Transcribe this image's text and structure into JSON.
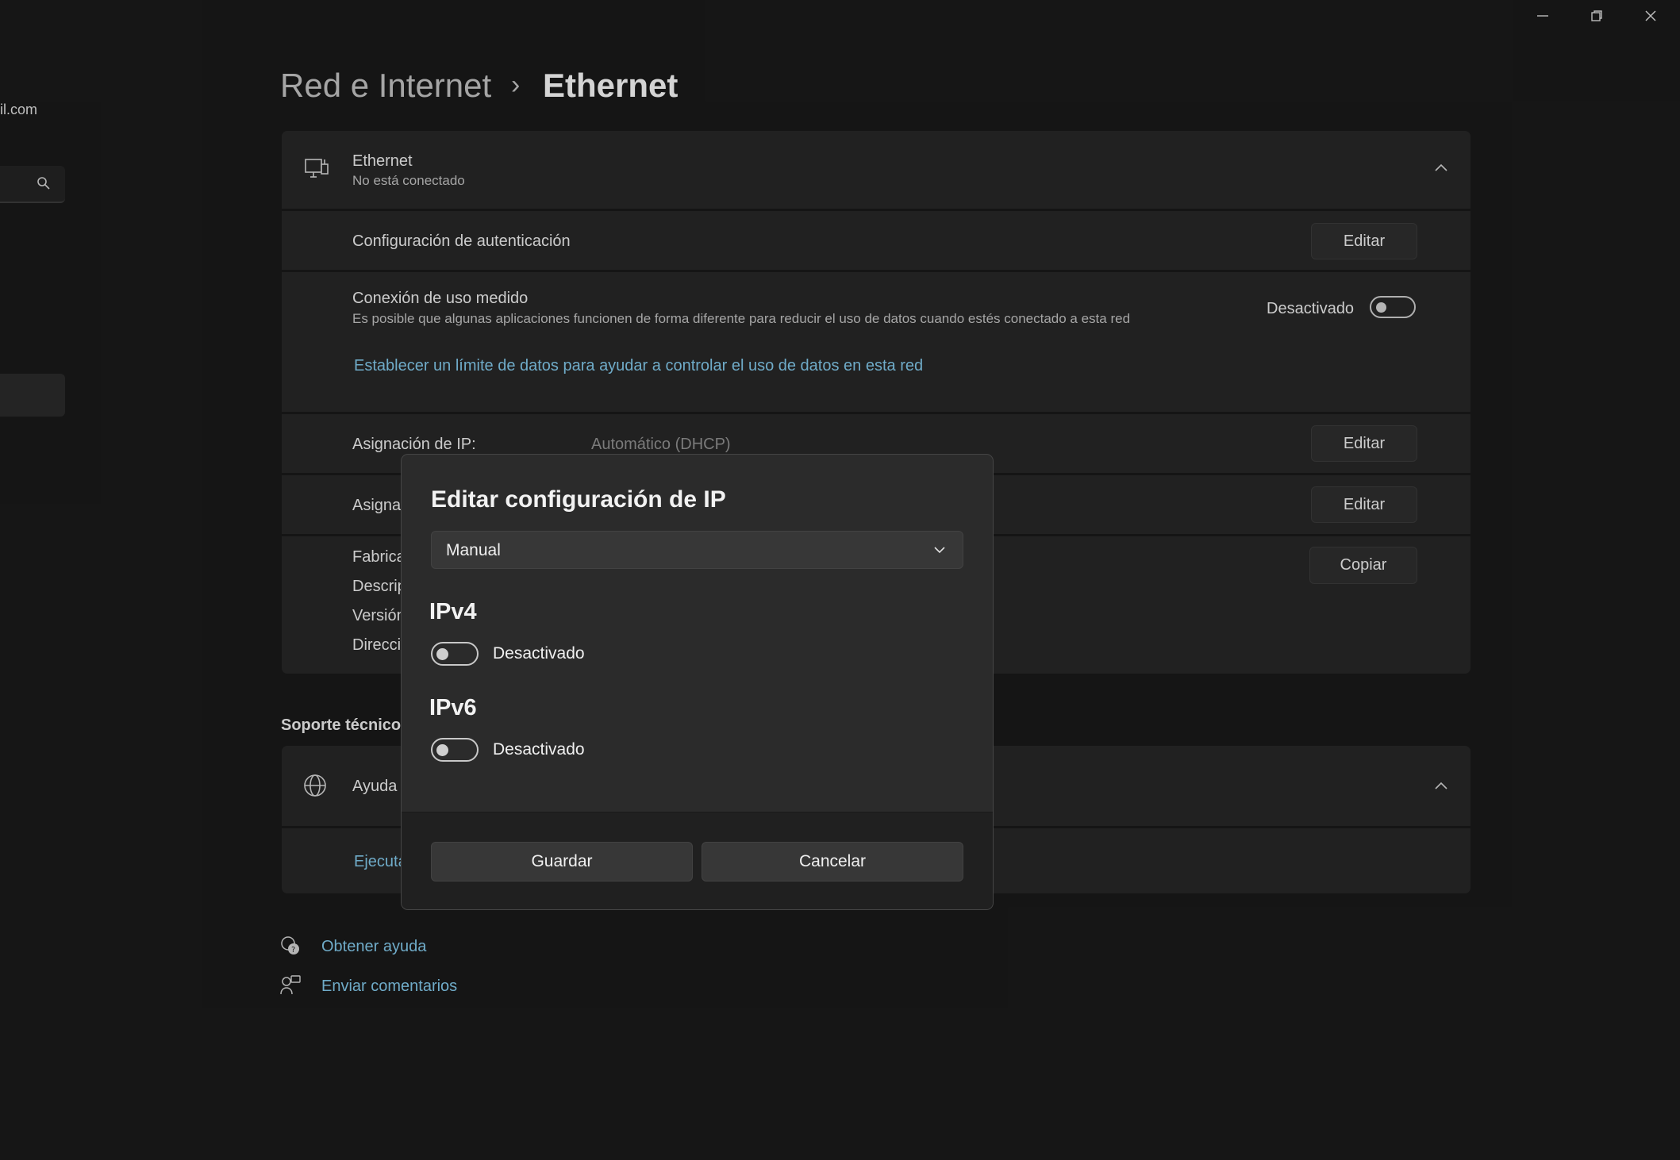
{
  "window": {
    "minimize_icon": "minimize-icon",
    "restore_icon": "restore-icon",
    "close_icon": "close-icon"
  },
  "sidebar": {
    "account_email": "il.com",
    "search_icon": "search-icon"
  },
  "breadcrumb": {
    "parent": "Red e Internet",
    "separator": "›",
    "current": "Ethernet"
  },
  "ethernet_card": {
    "title": "Ethernet",
    "status": "No está conectado"
  },
  "auth": {
    "label": "Configuración de autenticación",
    "button": "Editar"
  },
  "metered": {
    "title": "Conexión de uso medido",
    "description": "Es posible que algunas aplicaciones funcionen de forma diferente para reducir el uso de datos cuando estés conectado a esta red",
    "state": "Desactivado",
    "link": "Establecer un límite de datos para ayudar a controlar el uso de datos en esta red"
  },
  "ip_assignment": {
    "label": "Asignación de IP:",
    "value": "Automático (DHCP)",
    "button": "Editar"
  },
  "dns_assignment": {
    "label_partial": "Asigna",
    "button": "Editar"
  },
  "properties": {
    "labels": [
      "Fabrica",
      "Descrip",
      "Versión",
      "Direcci"
    ],
    "button": "Copiar"
  },
  "support": {
    "section_title": "Soporte técnico",
    "help_title": "Ayuda",
    "link_partial": "Ejecuta"
  },
  "footer_links": {
    "get_help": "Obtener ayuda",
    "feedback": "Enviar comentarios"
  },
  "dialog": {
    "title": "Editar configuración de IP",
    "dropdown_value": "Manual",
    "ipv4_heading": "IPv4",
    "ipv4_state": "Desactivado",
    "ipv6_heading": "IPv6",
    "ipv6_state": "Desactivado",
    "save": "Guardar",
    "cancel": "Cancelar"
  }
}
